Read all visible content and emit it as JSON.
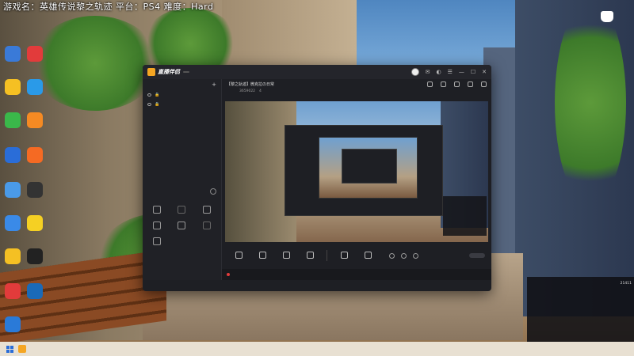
{
  "game_info": "游戏名：英雄传说黎之轨迹 平台：PS4 难度：Hard",
  "desktop_icons": [
    {
      "label": "",
      "color": "#3a7ad8"
    },
    {
      "label": "",
      "color": "#e23b3b"
    },
    {
      "label": "",
      "color": "#f5c023"
    },
    {
      "label": "",
      "color": "#2a9ae8"
    },
    {
      "label": "",
      "color": "#3ab84a"
    },
    {
      "label": "",
      "color": "#f58a23"
    },
    {
      "label": "",
      "color": "#2a6dd8"
    },
    {
      "label": "",
      "color": "#f56a23"
    },
    {
      "label": "",
      "color": "#4a9ae8"
    },
    {
      "label": "",
      "color": "#333333"
    },
    {
      "label": "",
      "color": "#3a8ae8"
    },
    {
      "label": "",
      "color": "#f5d023"
    },
    {
      "label": "",
      "color": "#f5c023"
    },
    {
      "label": "",
      "color": "#222222"
    },
    {
      "label": "",
      "color": "#e23b3b"
    },
    {
      "label": "",
      "color": "#1a6ab8"
    },
    {
      "label": "",
      "color": "#2a7ad8"
    }
  ],
  "window": {
    "app_name": "直播伴侣",
    "version": "",
    "left_tabs": [
      "",
      "",
      ""
    ],
    "scenes": [
      "",
      ""
    ],
    "toolbox_title": "",
    "toolbox_tabs": [
      "",
      "",
      ""
    ],
    "tools": [
      {
        "label": "",
        "dim": false,
        "badge": ""
      },
      {
        "label": "",
        "dim": true,
        "badge": ""
      },
      {
        "label": "",
        "dim": false,
        "badge": ""
      },
      {
        "label": "",
        "dim": false,
        "badge": ""
      },
      {
        "label": "",
        "dim": false,
        "badge": ""
      },
      {
        "label": "",
        "dim": true,
        "badge": ""
      },
      {
        "label": "",
        "dim": false,
        "badge": ""
      }
    ],
    "stream_title": "【黎之轨迹】微克拉の日常",
    "stream_tag": "",
    "stream_meta": [
      "",
      "",
      "3659022",
      "4"
    ],
    "controls": [
      "",
      "",
      "",
      ""
    ],
    "controls2": [
      "",
      ""
    ],
    "go_live": "",
    "status_question": "",
    "status_metrics": [
      "",
      "",
      "",
      ""
    ]
  },
  "chat": {
    "title": "",
    "right": "",
    "counts": [
      "",
      "",
      "21411"
    ],
    "lines": [
      {
        "tag": "",
        "text": ""
      },
      {
        "tag": "",
        "text": ""
      },
      {
        "tag": "",
        "text": ""
      },
      {
        "tag": "",
        "text": ""
      },
      {
        "tag": "",
        "text": ""
      }
    ]
  }
}
